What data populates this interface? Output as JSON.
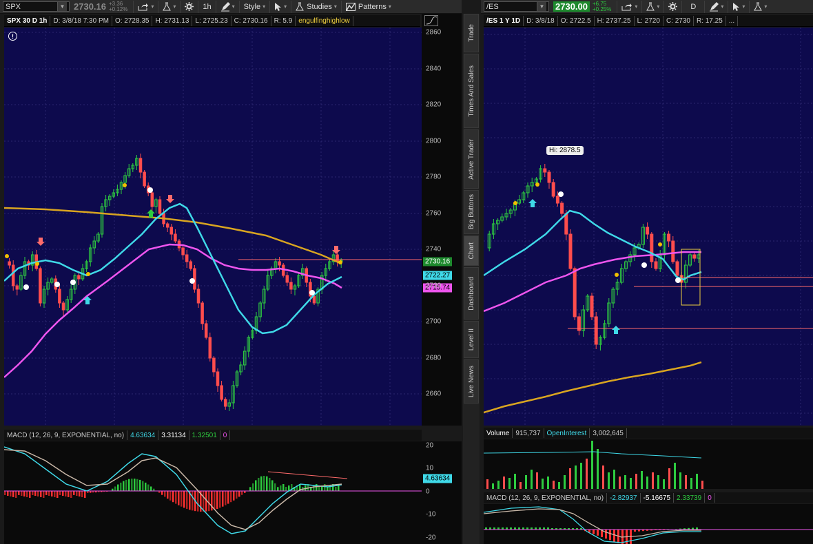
{
  "left": {
    "toolbar": {
      "symbol": "SPX",
      "price": "2730.16",
      "change_abs": "+3.36",
      "change_pct": "+0.12%",
      "share_icon": "share-icon",
      "flask_icon": "flask-icon",
      "gear_icon": "gear-icon",
      "timeframe": "1h",
      "style_label": "Style",
      "studies_label": "Studies",
      "patterns_label": "Patterns"
    },
    "info": {
      "title": "SPX 30 D 1h",
      "date": "D: 3/8/18 7:30 PM",
      "open": "O: 2728.35",
      "high": "H: 2731.13",
      "low": "L: 2725.23",
      "close": "C: 2730.16",
      "range": "R: 5.9",
      "study": "engulfinghighlow"
    },
    "axis_ticks": [
      "2860",
      "2840",
      "2820",
      "2800",
      "2780",
      "2760",
      "2740",
      "2720",
      "2700",
      "2680",
      "2660"
    ],
    "price_badges": {
      "last": "2730.16",
      "cyan_ma": "2722.27",
      "magenta_ma": "2715.74"
    },
    "macd_header": {
      "title": "MACD (12, 26, 9, EXPONENTIAL, no)",
      "v1": "4.63634",
      "v2": "3.31134",
      "v3": "1.32501",
      "v4": "0"
    },
    "macd_ticks": [
      "20",
      "10",
      "0",
      "-10",
      "-20"
    ],
    "macd_badge": "4.63634"
  },
  "right": {
    "toolbar": {
      "symbol": "/ES",
      "price": "2730.00",
      "change_abs": "+6.75",
      "change_pct": "+0.25%",
      "timeframe": "D"
    },
    "info": {
      "title": "/ES 1 Y 1D",
      "date": "D: 3/8/18",
      "open": "O: 2722.5",
      "high": "H: 2737.25",
      "low": "L: 2720",
      "close": "C: 2730",
      "range": "R: 17.25",
      "more": "..."
    },
    "hi_tooltip": "Hi: 2878.5",
    "volume_header": {
      "label": "Volume",
      "volume": "915,737",
      "oi_label": "OpenInterest",
      "oi": "3,002,645"
    },
    "macd_header": {
      "title": "MACD (12, 26, 9, EXPONENTIAL, no)",
      "v1": "-2.82937",
      "v2": "-5.16675",
      "v3": "2.33739",
      "v4": "0"
    }
  },
  "side_tabs": [
    "Trade",
    "Times And Sales",
    "Active Trader",
    "Big Buttons",
    "Chart",
    "Dashboard",
    "Level II",
    "Live News"
  ],
  "colors": {
    "bg_chart": "#0d0a4d",
    "up": "#2ecc40",
    "down": "#ff4d4d",
    "cyan": "#3fd9e8",
    "magenta": "#ee55ee",
    "gold": "#d9a520"
  }
}
